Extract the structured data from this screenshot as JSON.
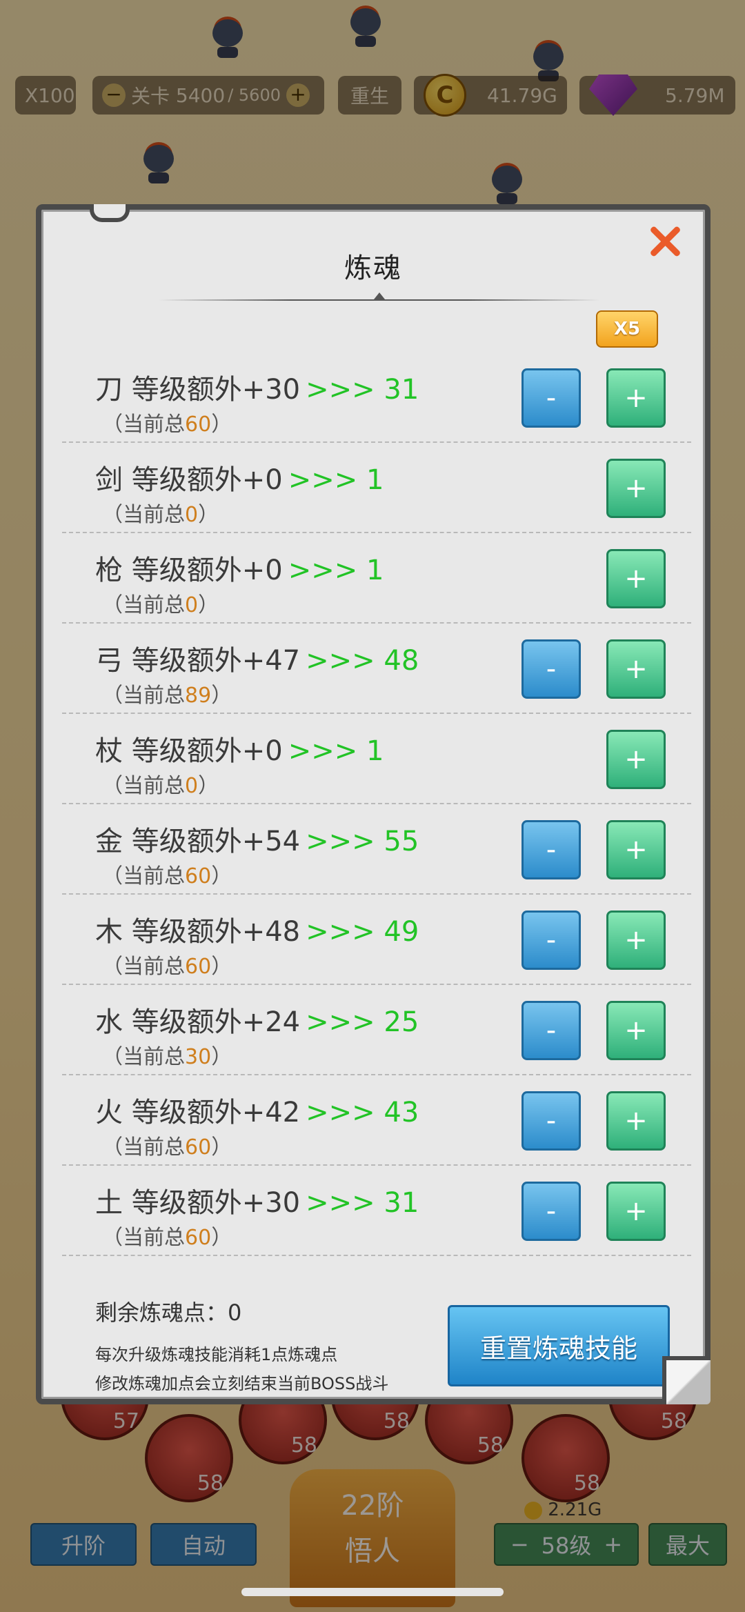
{
  "hud": {
    "speed_label": "X100",
    "stage_prefix": "关卡",
    "stage_current": "5400",
    "stage_total": "/ 5600",
    "rebirth_label": "重生",
    "gold_value": "41.79G",
    "gem_value": "5.79M",
    "gold_icon_char": "C"
  },
  "dialog": {
    "title": "炼魂",
    "multiplier_label": "X5",
    "minus_symbol": "-",
    "plus_symbol": "+",
    "rows": [
      {
        "label": "刀 等级额外+30",
        "arrow": ">>> 31",
        "sub_prefix": "（当前总",
        "sub_value": "60",
        "sub_suffix": "）",
        "has_minus": true
      },
      {
        "label": "剑 等级额外+0",
        "arrow": ">>> 1",
        "sub_prefix": "（当前总",
        "sub_value": "0",
        "sub_suffix": "）",
        "has_minus": false
      },
      {
        "label": "枪 等级额外+0",
        "arrow": ">>> 1",
        "sub_prefix": "（当前总",
        "sub_value": "0",
        "sub_suffix": "）",
        "has_minus": false
      },
      {
        "label": "弓 等级额外+47",
        "arrow": ">>> 48",
        "sub_prefix": "（当前总",
        "sub_value": "89",
        "sub_suffix": "）",
        "has_minus": true
      },
      {
        "label": "杖 等级额外+0",
        "arrow": ">>> 1",
        "sub_prefix": "（当前总",
        "sub_value": "0",
        "sub_suffix": "）",
        "has_minus": false
      },
      {
        "label": "金 等级额外+54",
        "arrow": ">>> 55",
        "sub_prefix": "（当前总",
        "sub_value": "60",
        "sub_suffix": "）",
        "has_minus": true
      },
      {
        "label": "木 等级额外+48",
        "arrow": ">>> 49",
        "sub_prefix": "（当前总",
        "sub_value": "60",
        "sub_suffix": "）",
        "has_minus": true
      },
      {
        "label": "水 等级额外+24",
        "arrow": ">>> 25",
        "sub_prefix": "（当前总",
        "sub_value": "30",
        "sub_suffix": "）",
        "has_minus": true
      },
      {
        "label": "火 等级额外+42",
        "arrow": ">>> 43",
        "sub_prefix": "（当前总",
        "sub_value": "60",
        "sub_suffix": "）",
        "has_minus": true
      },
      {
        "label": "土 等级额外+30",
        "arrow": ">>> 31",
        "sub_prefix": "（当前总",
        "sub_value": "60",
        "sub_suffix": "）",
        "has_minus": true
      }
    ],
    "remaining_points": "剩余炼魂点：0",
    "note_1": "每次升级炼魂技能消耗1点炼魂点",
    "note_2": "修改炼魂加点会立刻结束当前BOSS战斗",
    "reset_label": "重置炼魂技能"
  },
  "bottom": {
    "zodiac_levels": [
      "57",
      "58",
      "58",
      "58",
      "58",
      "58",
      "58"
    ],
    "upgrade_label": "升阶",
    "auto_label": "自动",
    "rank_number": "22阶",
    "rank_name": "悟人",
    "cost": "2.21G",
    "level_label": "58级",
    "max_label": "最大"
  },
  "colors": {
    "accent_green": "#22c326",
    "number_orange": "#cf7f1e",
    "close_red": "#ea5b2a"
  }
}
